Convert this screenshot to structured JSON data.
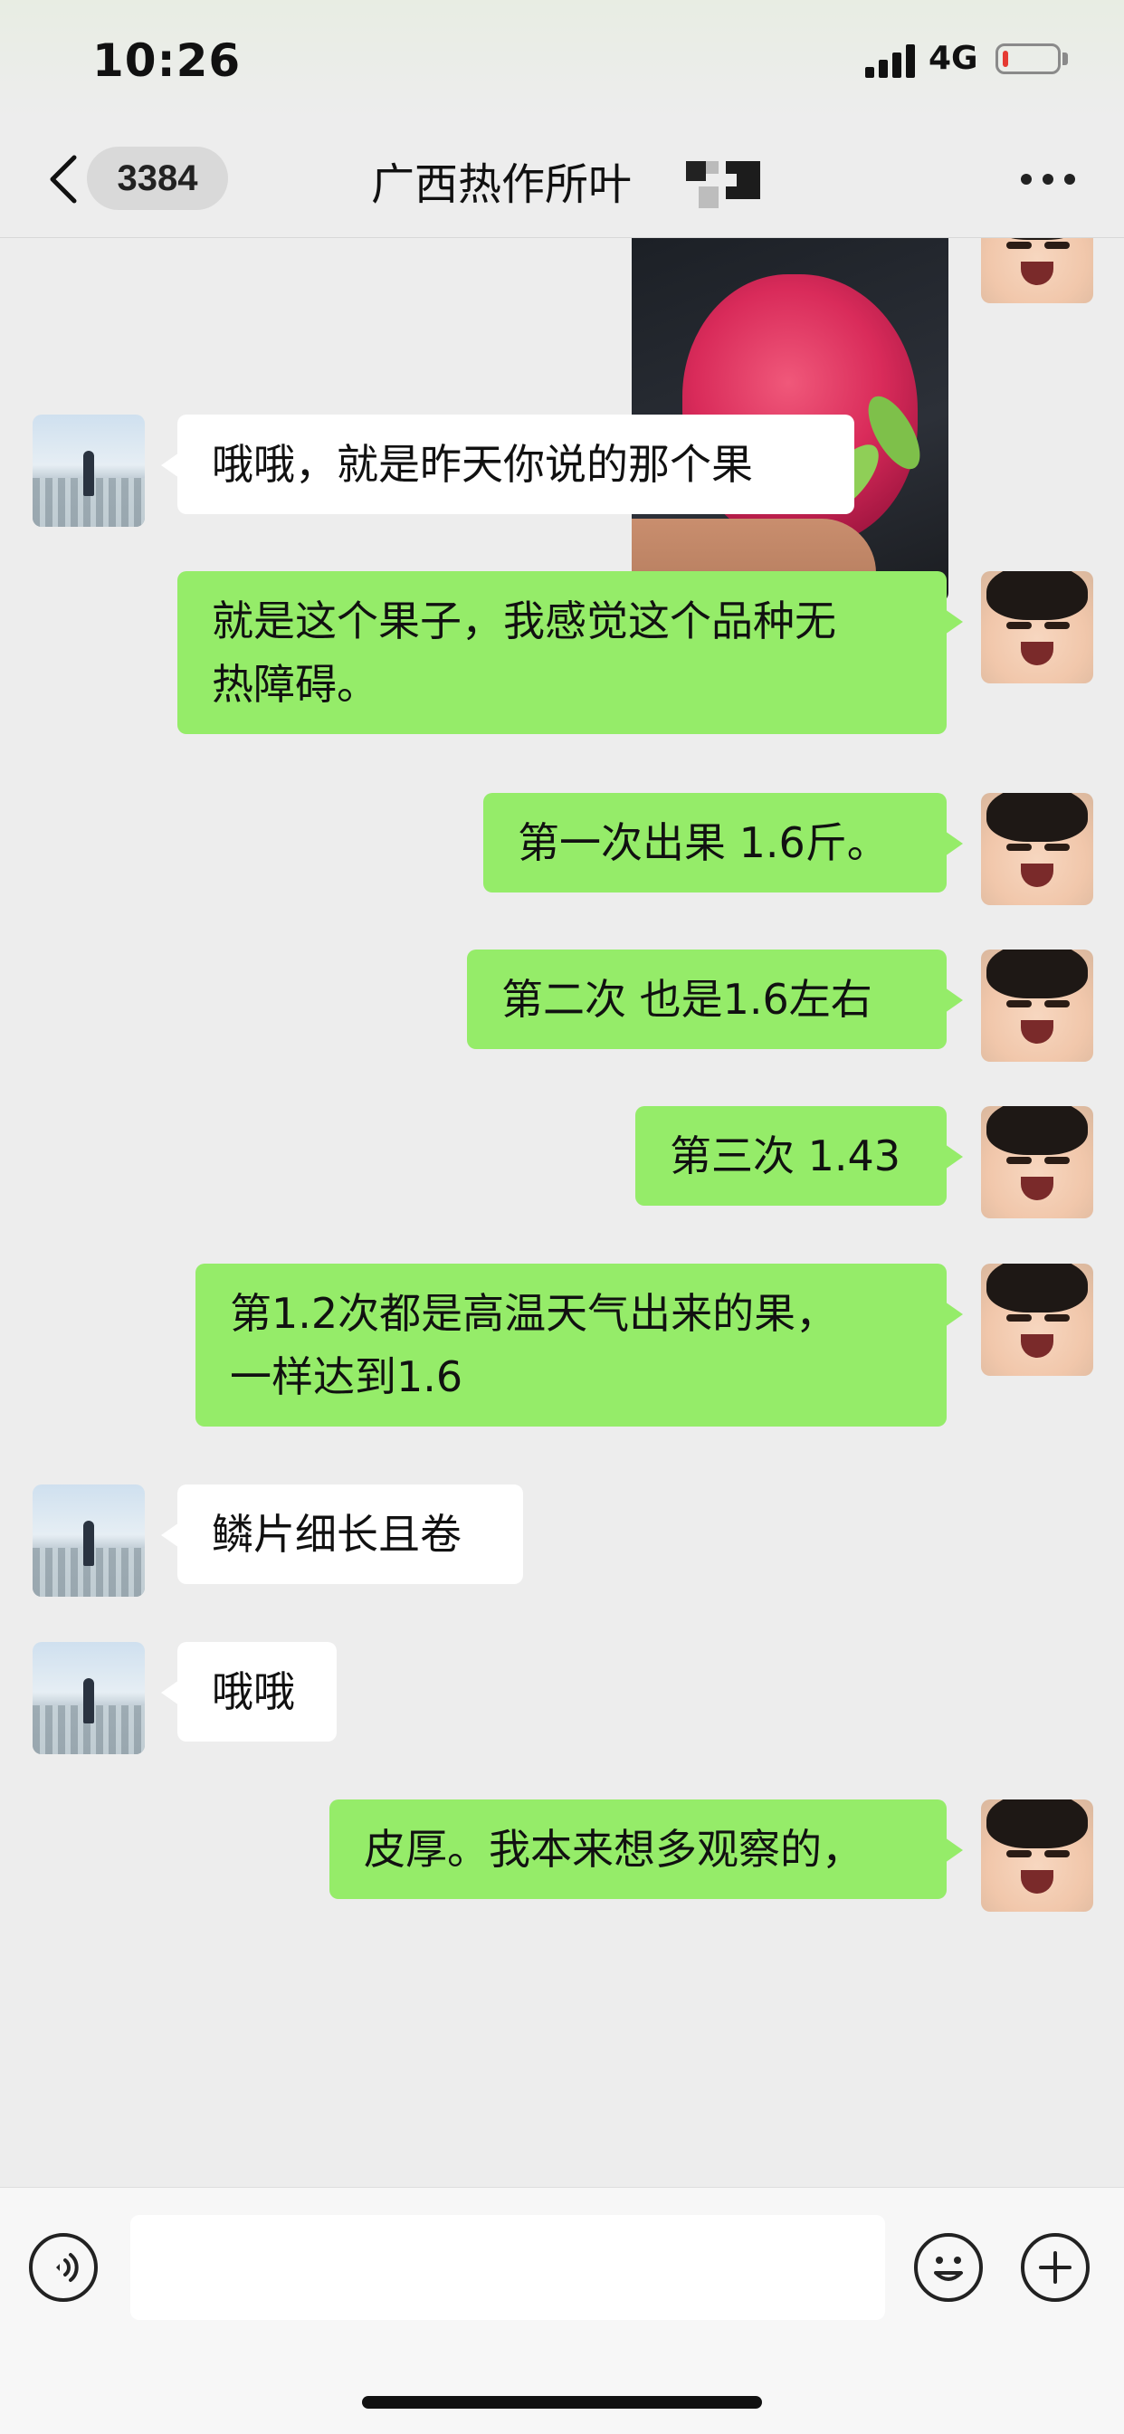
{
  "status_bar": {
    "time": "10:26",
    "network": "4G",
    "battery_level": 0.08,
    "colors": {
      "battery_low": "#e53a32"
    }
  },
  "nav": {
    "back_icon": "chevron-left-icon",
    "unread_count": "3384",
    "chat_title": "广西热作所叶",
    "more_icon": "more-dots-icon"
  },
  "messages": [
    {
      "side": "right",
      "type": "image",
      "alt_icon": "dragon-fruit-photo"
    },
    {
      "side": "left",
      "type": "text",
      "text": "哦哦，就是昨天你说的那个果"
    },
    {
      "side": "right",
      "type": "text",
      "lines": [
        "就是这个果子，我感觉这个品种无",
        "热障碍。"
      ]
    },
    {
      "side": "right",
      "type": "text",
      "text": "第一次出果 1.6斤。"
    },
    {
      "side": "right",
      "type": "text",
      "text": "第二次 也是1.6左右"
    },
    {
      "side": "right",
      "type": "text",
      "text": "第三次 1.43"
    },
    {
      "side": "right",
      "type": "text",
      "lines": [
        "第1.2次都是高温天气出来的果，",
        "一样达到1.6"
      ]
    },
    {
      "side": "left",
      "type": "text",
      "text": "鳞片细长且卷"
    },
    {
      "side": "left",
      "type": "text",
      "text": "哦哦"
    },
    {
      "side": "right",
      "type": "text",
      "text": "皮厚。我本来想多观察的，"
    }
  ],
  "input_bar": {
    "voice_icon": "voice-icon",
    "placeholder": "",
    "emoji_icon": "smile-emoji-icon",
    "plus_icon": "plus-icon"
  },
  "colors": {
    "background": "#ededed",
    "bubble_mine": "#95ec69",
    "bubble_theirs": "#ffffff"
  }
}
